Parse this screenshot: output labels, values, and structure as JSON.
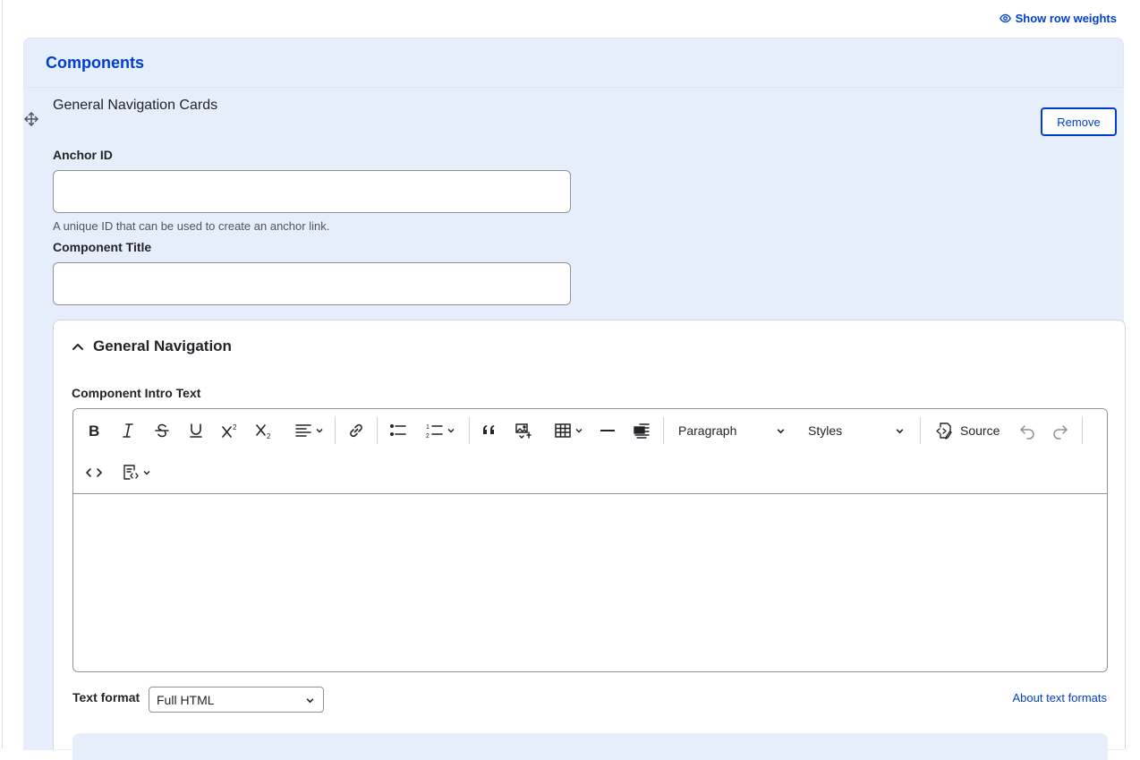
{
  "header": {
    "show_row_weights": "Show row weights"
  },
  "components": {
    "title": "Components",
    "paragraph_type": "General Navigation Cards",
    "remove_label": "Remove"
  },
  "fields": {
    "anchor_id": {
      "label": "Anchor ID",
      "value": "",
      "help": "A unique ID that can be used to create an anchor link."
    },
    "component_title": {
      "label": "Component Title",
      "value": ""
    }
  },
  "general_navigation": {
    "summary": "General Navigation",
    "intro_label": "Component Intro Text",
    "toolbar": {
      "paragraph_select": "Paragraph",
      "styles_select": "Styles",
      "source_label": "Source"
    },
    "text_format": {
      "label": "Text format",
      "selected": "Full HTML",
      "about_link": "About text formats"
    }
  },
  "colors": {
    "accent": "#003ecc",
    "panel_bg": "#e6edfb",
    "border": "#8e929c"
  },
  "icons": [
    "eye-icon",
    "move-icon",
    "chevron-up-icon",
    "bold-icon",
    "italic-icon",
    "strikethrough-icon",
    "underline-icon",
    "superscript-icon",
    "subscript-icon",
    "align-icon",
    "link-icon",
    "bulleted-list-icon",
    "numbered-list-icon",
    "blockquote-icon",
    "image-icon",
    "table-icon",
    "horizontal-line-icon",
    "media-icon",
    "source-icon",
    "undo-icon",
    "redo-icon",
    "code-icon",
    "code-block-icon",
    "chevron-down-icon"
  ]
}
